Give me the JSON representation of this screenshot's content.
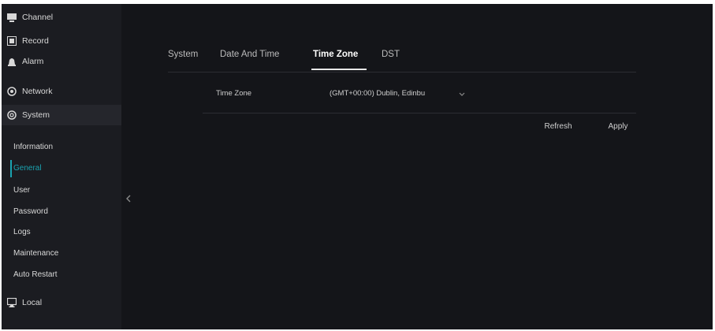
{
  "sidebar": {
    "items": [
      {
        "label": "Channel",
        "icon": "channel-icon"
      },
      {
        "label": "Record",
        "icon": "record-icon"
      },
      {
        "label": "Alarm",
        "icon": "alarm-icon"
      },
      {
        "label": "Network",
        "icon": "network-icon"
      },
      {
        "label": "System",
        "icon": "system-gear-icon"
      }
    ],
    "system_subitems": [
      {
        "label": "Information"
      },
      {
        "label": "General"
      },
      {
        "label": "User"
      },
      {
        "label": "Password"
      },
      {
        "label": "Logs"
      },
      {
        "label": "Maintenance"
      },
      {
        "label": "Auto Restart"
      }
    ],
    "selected_subitem": "General",
    "bottom_item": {
      "label": "Local",
      "icon": "local-monitor-icon"
    }
  },
  "tabs": [
    {
      "label": "System",
      "active": false
    },
    {
      "label": "Date And Time",
      "active": false
    },
    {
      "label": "Time Zone",
      "active": true
    },
    {
      "label": "DST",
      "active": false
    }
  ],
  "form": {
    "time_zone": {
      "label": "Time Zone",
      "value": "(GMT+00:00) Dublin, Edinbu"
    }
  },
  "buttons": {
    "refresh": "Refresh",
    "apply": "Apply"
  },
  "colors": {
    "background": "#141519",
    "sidebar": "#1b1c21",
    "accent": "#1aa3b0",
    "text": "#d8d8d8"
  }
}
